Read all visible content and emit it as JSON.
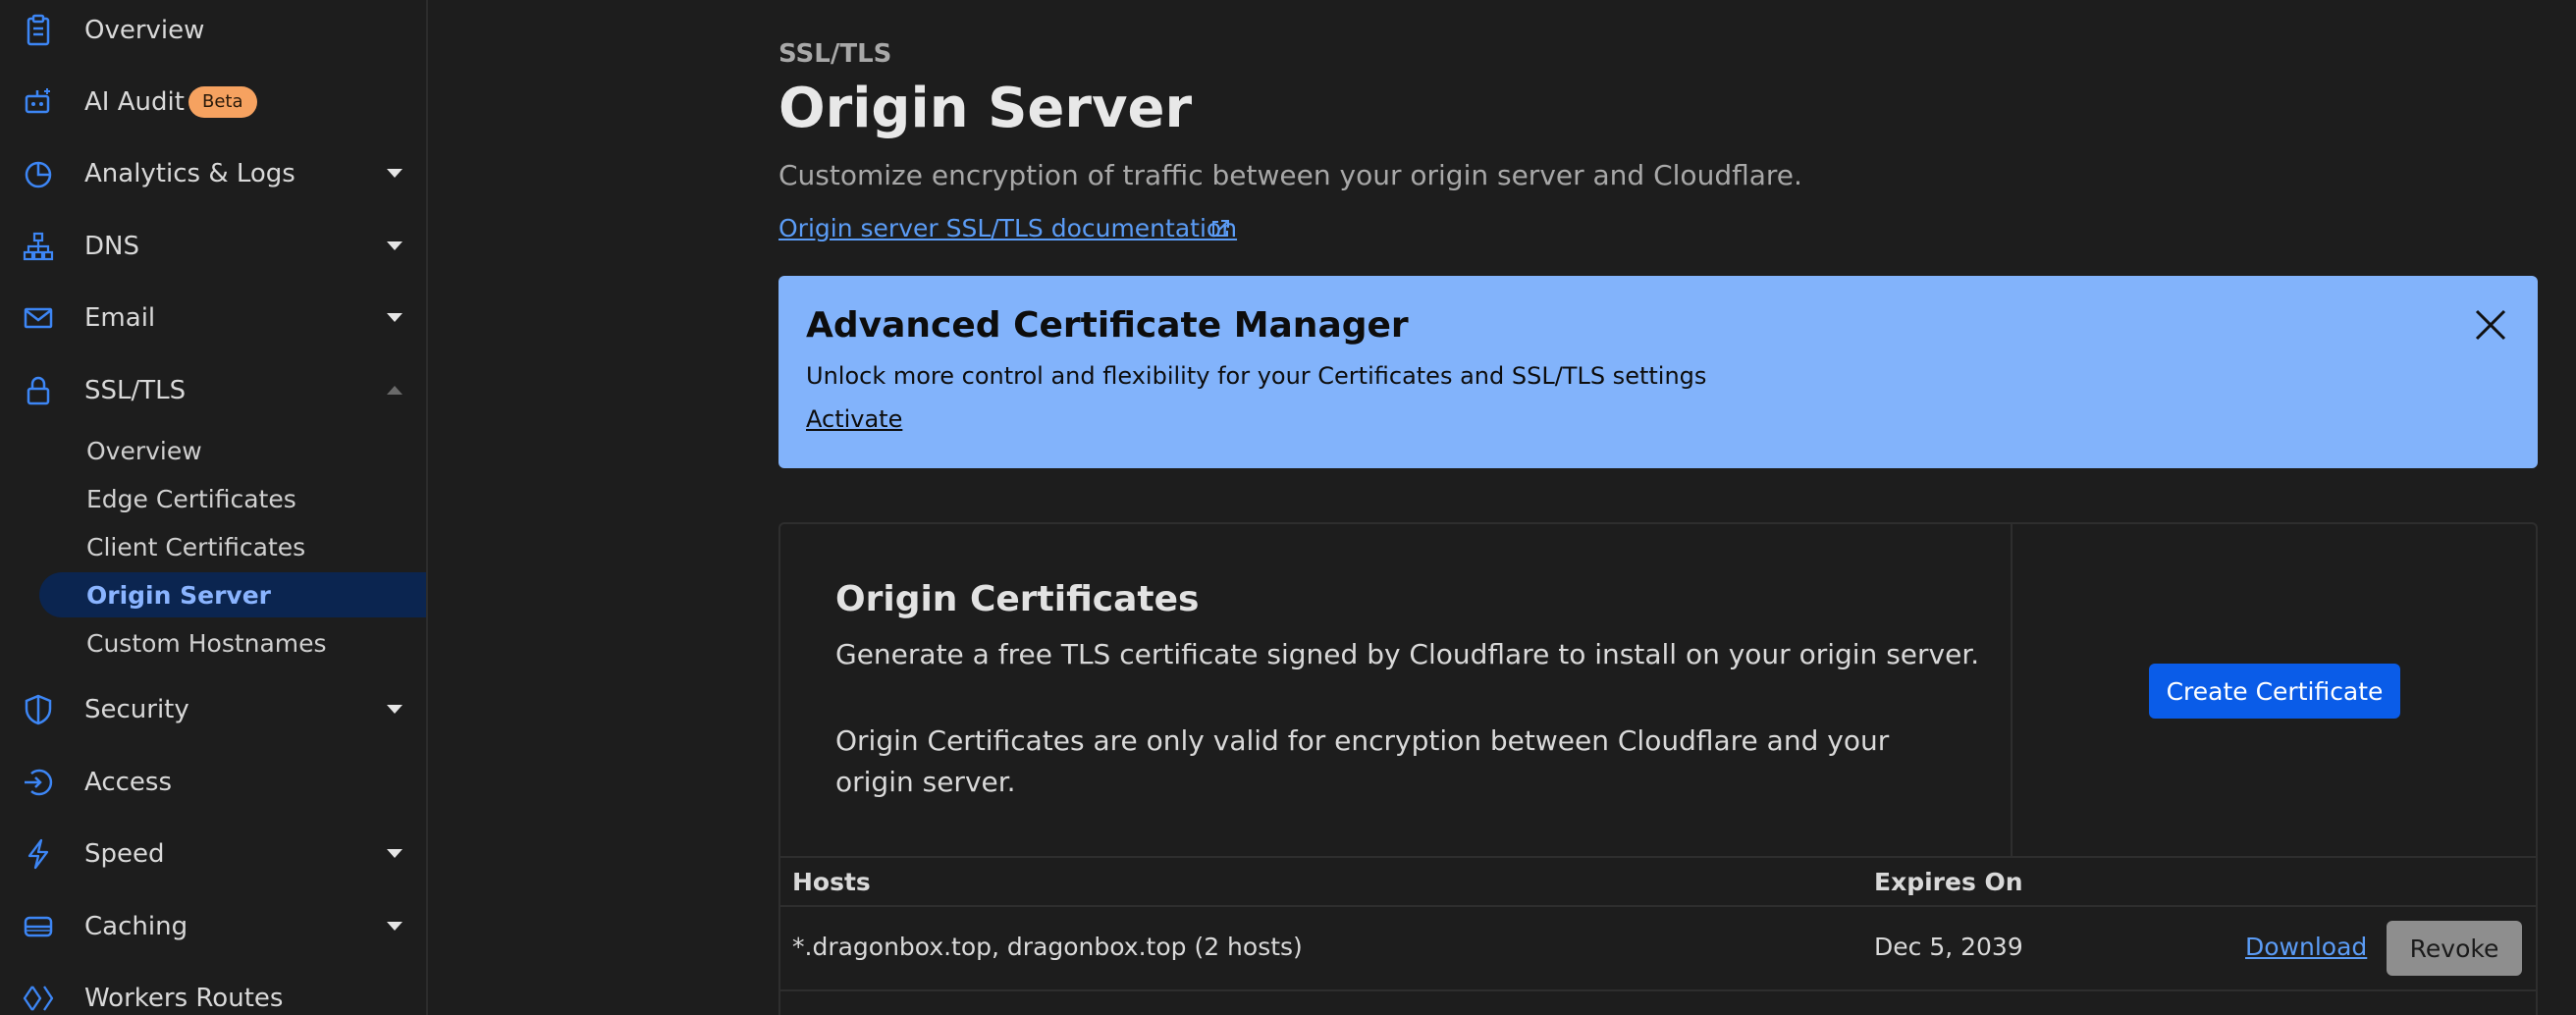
{
  "sidebar": {
    "items": [
      {
        "label": "Overview"
      },
      {
        "label": "AI Audit",
        "badge": "Beta"
      },
      {
        "label": "Analytics & Logs"
      },
      {
        "label": "DNS"
      },
      {
        "label": "Email"
      },
      {
        "label": "SSL/TLS"
      },
      {
        "label": "Security"
      },
      {
        "label": "Access"
      },
      {
        "label": "Speed"
      },
      {
        "label": "Caching"
      },
      {
        "label": "Workers Routes"
      }
    ],
    "ssl_sub": [
      {
        "label": "Overview"
      },
      {
        "label": "Edge Certificates"
      },
      {
        "label": "Client Certificates"
      },
      {
        "label": "Origin Server"
      },
      {
        "label": "Custom Hostnames"
      }
    ]
  },
  "header": {
    "breadcrumb": "SSL/TLS",
    "title": "Origin Server",
    "subtitle": "Customize encryption of traffic between your origin server and Cloudflare.",
    "doc_link": "Origin server SSL/TLS documentation"
  },
  "banner": {
    "title": "Advanced Certificate Manager",
    "text": "Unlock more control and flexibility for your Certificates and SSL/TLS settings",
    "link": "Activate"
  },
  "card": {
    "title": "Origin Certificates",
    "text1": "Generate a free TLS certificate signed by Cloudflare to install on your origin server.",
    "text2": "Origin Certificates are only valid for encryption between Cloudflare and your origin server.",
    "button": "Create Certificate"
  },
  "table": {
    "columns": [
      "Hosts",
      "Expires On"
    ],
    "rows": [
      {
        "hosts": "*.dragonbox.top, dragonbox.top (2 hosts)",
        "expires": "Dec 5, 2039",
        "download": "Download",
        "revoke": "Revoke"
      }
    ]
  },
  "colors": {
    "accent": "#0a5ce8",
    "link": "#5b9cf6",
    "banner": "#82b3fb",
    "beta": "#f6a260"
  }
}
